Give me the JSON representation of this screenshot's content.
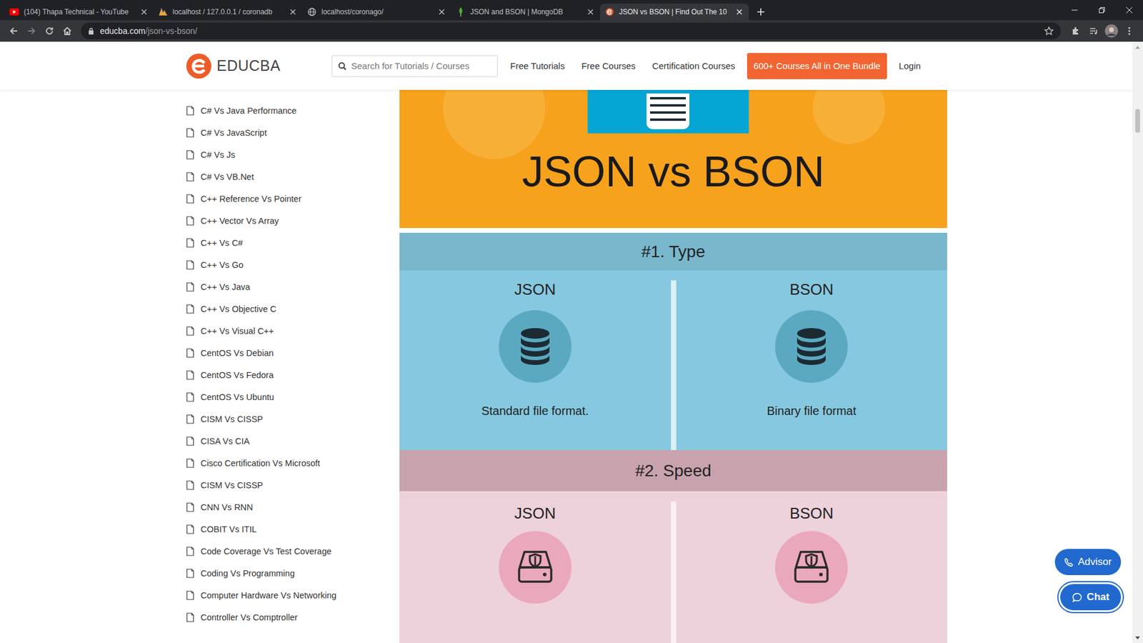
{
  "window": {
    "tabs": [
      {
        "label": "(104) Thapa Technical - YouTube",
        "selected": false,
        "kind": "youtube"
      },
      {
        "label": "localhost / 127.0.0.1 / coronadb",
        "selected": false,
        "kind": "phpmyadmin"
      },
      {
        "label": "localhost/coronago/",
        "selected": false,
        "kind": "globe"
      },
      {
        "label": "JSON and BSON | MongoDB",
        "selected": false,
        "kind": "mongodb"
      },
      {
        "label": "JSON vs BSON | Find Out The 10",
        "selected": true,
        "kind": "educba"
      }
    ],
    "address": {
      "host": "educba.com",
      "path": "/json-vs-bson/"
    }
  },
  "header": {
    "logo": "EDUCBA",
    "search": {
      "placeholder": "Search for Tutorials / Courses"
    },
    "nav": [
      "Free Tutorials",
      "Free Courses",
      "Certification Courses"
    ],
    "cta": "600+ Courses All in One Bundle",
    "login": "Login"
  },
  "sidebar": {
    "items": [
      "C# Vs Java Performance",
      "C# Vs JavaScript",
      "C# Vs Js",
      "C# Vs VB.Net",
      "C++ Reference Vs Pointer",
      "C++ Vector Vs Array",
      "C++ Vs C#",
      "C++ Vs Go",
      "C++ Vs Java",
      "C++ Vs Objective C",
      "C++ Vs Visual C++",
      "CentOS Vs Debian",
      "CentOS Vs Fedora",
      "CentOS Vs Ubuntu",
      "CISM Vs CISSP",
      "CISA Vs CIA",
      "Cisco Certification Vs Microsoft",
      "CISM Vs CISSP",
      "CNN Vs RNN",
      "COBIT Vs ITIL",
      "Code Coverage Vs Test Coverage",
      "Coding Vs Programming",
      "Computer Hardware Vs Networking",
      "Controller Vs Comptroller"
    ]
  },
  "infographic": {
    "title": "JSON vs BSON",
    "sections": [
      {
        "heading": "#1. Type",
        "color": "#79b7cc",
        "body_color": "#86c8df",
        "kind": "database",
        "columns": [
          {
            "label": "JSON",
            "caption": "Standard file format."
          },
          {
            "label": "BSON",
            "caption": "Binary file format"
          }
        ]
      },
      {
        "heading": "#2. Speed",
        "color": "#c8a3ae",
        "body_color": "#edd1db",
        "kind": "drive",
        "columns": [
          {
            "label": "JSON"
          },
          {
            "label": "BSON"
          }
        ]
      }
    ]
  },
  "floating": {
    "advisor": "Advisor",
    "chat": "Chat"
  }
}
